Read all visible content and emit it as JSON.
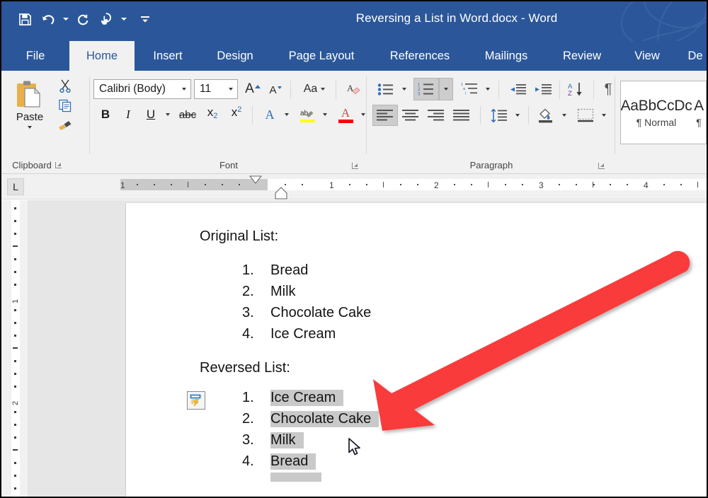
{
  "window": {
    "title": "Reversing a List in Word.docx - Word",
    "theme_color": "#2b579a"
  },
  "quick_access": [
    {
      "name": "save",
      "icon": "save-icon"
    },
    {
      "name": "undo",
      "icon": "undo-icon"
    },
    {
      "name": "redo",
      "icon": "redo-icon"
    },
    {
      "name": "touch-mouse-mode",
      "icon": "touch-mode-icon"
    },
    {
      "name": "customize-quick-access-toolbar",
      "icon": "overflow-icon"
    }
  ],
  "tabs": [
    {
      "label": "File",
      "active": false
    },
    {
      "label": "Home",
      "active": true
    },
    {
      "label": "Insert",
      "active": false
    },
    {
      "label": "Design",
      "active": false
    },
    {
      "label": "Page Layout",
      "active": false
    },
    {
      "label": "References",
      "active": false
    },
    {
      "label": "Mailings",
      "active": false
    },
    {
      "label": "Review",
      "active": false
    },
    {
      "label": "View",
      "active": false
    },
    {
      "label": "De",
      "active": false
    }
  ],
  "ribbon": {
    "groups": [
      {
        "label": "Clipboard"
      },
      {
        "label": "Font"
      },
      {
        "label": "Paragraph"
      }
    ],
    "clipboard": {
      "paste_label": "Paste",
      "cut_icon": "scissors-icon",
      "copy_icon": "copy-icon",
      "format_painter_icon": "format-painter-icon"
    },
    "font": {
      "font_name": "Calibri (Body)",
      "font_size": "11",
      "grow_font": "A",
      "shrink_font": "A",
      "change_case": "Aa",
      "clear_formatting_icon": "clear-formatting-icon",
      "bold": "B",
      "italic": "I",
      "underline": "U",
      "strikethrough": "abc",
      "subscript": "x",
      "subscript_sub": "2",
      "superscript": "x",
      "superscript_sup": "2",
      "text_effects": "A",
      "highlight_color": "#ffff00",
      "font_color": "#ff0000"
    },
    "paragraph": {
      "bullets_icon": "bullet-list-icon",
      "numbering_icon": "numbered-list-icon",
      "numbering_active": true,
      "multilevel_icon": "multilevel-list-icon",
      "decrease_indent_icon": "decrease-indent-icon",
      "increase_indent_icon": "increase-indent-icon",
      "sort_icon": "sort-az-icon",
      "show_marks_icon": "pilcrow-icon",
      "align_left_icon": "align-left-icon",
      "align_left_active": true,
      "align_center_icon": "align-center-icon",
      "align_right_icon": "align-right-icon",
      "justify_icon": "justify-icon",
      "line_spacing_icon": "line-spacing-icon",
      "shading_icon": "shading-icon",
      "borders_icon": "borders-icon"
    },
    "styles": [
      {
        "preview": "AaBbCcDc",
        "name": "Normal"
      },
      {
        "preview": "A",
        "name": "¶"
      }
    ]
  },
  "ruler": {
    "tab_stop_selector": "L",
    "horizontal_ticks": [
      "1",
      "1",
      "2",
      "3",
      "4"
    ],
    "vertical_ticks": [
      "1",
      "2"
    ]
  },
  "document": {
    "sections": [
      {
        "heading": "Original List:",
        "selected": false,
        "items": [
          {
            "num": "1.",
            "text": "Bread"
          },
          {
            "num": "2.",
            "text": "Milk"
          },
          {
            "num": "3.",
            "text": "Chocolate Cake"
          },
          {
            "num": "4.",
            "text": "Ice Cream"
          }
        ]
      },
      {
        "heading": "Reversed List:",
        "selected": true,
        "items": [
          {
            "num": "1.",
            "text": "Ice Cream"
          },
          {
            "num": "2.",
            "text": "Chocolate Cake"
          },
          {
            "num": "3.",
            "text": "Milk"
          },
          {
            "num": "4.",
            "text": "Bread"
          }
        ]
      }
    ],
    "smart_tag_icon": "autocorrect-options-icon",
    "selection_color": "#c9c9c9"
  },
  "annotation": {
    "arrow_color": "#f93a3a",
    "arrow_direction": "down-left"
  },
  "cursor": {
    "icon": "mouse-pointer-icon"
  }
}
